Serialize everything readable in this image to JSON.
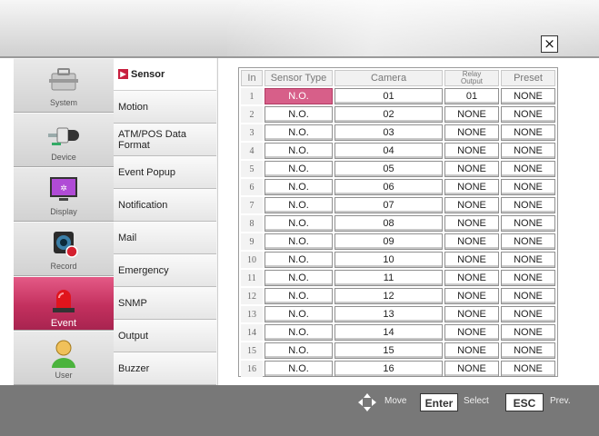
{
  "window": {
    "close_glyph": "×"
  },
  "categories": [
    {
      "label": "System",
      "icon": "toolbox-icon"
    },
    {
      "label": "Device",
      "icon": "plug-icon"
    },
    {
      "label": "Display",
      "icon": "monitor-icon"
    },
    {
      "label": "Record",
      "icon": "record-camera-icon"
    },
    {
      "label": "Event",
      "icon": "alarm-light-icon",
      "active": true
    },
    {
      "label": "User",
      "icon": "user-icon"
    }
  ],
  "submenu": [
    {
      "label": "Sensor",
      "active": true
    },
    {
      "label": "Motion"
    },
    {
      "label": "ATM/POS Data Format",
      "line1": "ATM/POS Data",
      "line2": "Format"
    },
    {
      "label": "Event Popup"
    },
    {
      "label": "Notification"
    },
    {
      "label": "Mail"
    },
    {
      "label": "Emergency"
    },
    {
      "label": "SNMP"
    },
    {
      "label": "Output"
    },
    {
      "label": "Buzzer"
    }
  ],
  "table": {
    "headers": {
      "in": "In",
      "sensor_type": "Sensor Type",
      "camera": "Camera",
      "relay_line1": "Relay",
      "relay_line2": "Output",
      "preset": "Preset"
    },
    "rows": [
      {
        "in": "1",
        "sensor_type": "N.O.",
        "camera": "01",
        "relay": "01",
        "preset": "NONE"
      },
      {
        "in": "2",
        "sensor_type": "N.O.",
        "camera": "02",
        "relay": "NONE",
        "preset": "NONE"
      },
      {
        "in": "3",
        "sensor_type": "N.O.",
        "camera": "03",
        "relay": "NONE",
        "preset": "NONE"
      },
      {
        "in": "4",
        "sensor_type": "N.O.",
        "camera": "04",
        "relay": "NONE",
        "preset": "NONE"
      },
      {
        "in": "5",
        "sensor_type": "N.O.",
        "camera": "05",
        "relay": "NONE",
        "preset": "NONE"
      },
      {
        "in": "6",
        "sensor_type": "N.O.",
        "camera": "06",
        "relay": "NONE",
        "preset": "NONE"
      },
      {
        "in": "7",
        "sensor_type": "N.O.",
        "camera": "07",
        "relay": "NONE",
        "preset": "NONE"
      },
      {
        "in": "8",
        "sensor_type": "N.O.",
        "camera": "08",
        "relay": "NONE",
        "preset": "NONE"
      },
      {
        "in": "9",
        "sensor_type": "N.O.",
        "camera": "09",
        "relay": "NONE",
        "preset": "NONE"
      },
      {
        "in": "10",
        "sensor_type": "N.O.",
        "camera": "10",
        "relay": "NONE",
        "preset": "NONE"
      },
      {
        "in": "11",
        "sensor_type": "N.O.",
        "camera": "11",
        "relay": "NONE",
        "preset": "NONE"
      },
      {
        "in": "12",
        "sensor_type": "N.O.",
        "camera": "12",
        "relay": "NONE",
        "preset": "NONE"
      },
      {
        "in": "13",
        "sensor_type": "N.O.",
        "camera": "13",
        "relay": "NONE",
        "preset": "NONE"
      },
      {
        "in": "14",
        "sensor_type": "N.O.",
        "camera": "14",
        "relay": "NONE",
        "preset": "NONE"
      },
      {
        "in": "15",
        "sensor_type": "N.O.",
        "camera": "15",
        "relay": "NONE",
        "preset": "NONE"
      },
      {
        "in": "16",
        "sensor_type": "N.O.",
        "camera": "16",
        "relay": "NONE",
        "preset": "NONE"
      }
    ]
  },
  "footer": {
    "move_label": "Move",
    "enter_key": "Enter",
    "select_label": "Select",
    "esc_key": "ESC",
    "prev_label": "Prev."
  },
  "colors": {
    "accent_pink": "#d75f89",
    "event_active": "#c3305e",
    "sensor_arrow": "#c8203f"
  }
}
